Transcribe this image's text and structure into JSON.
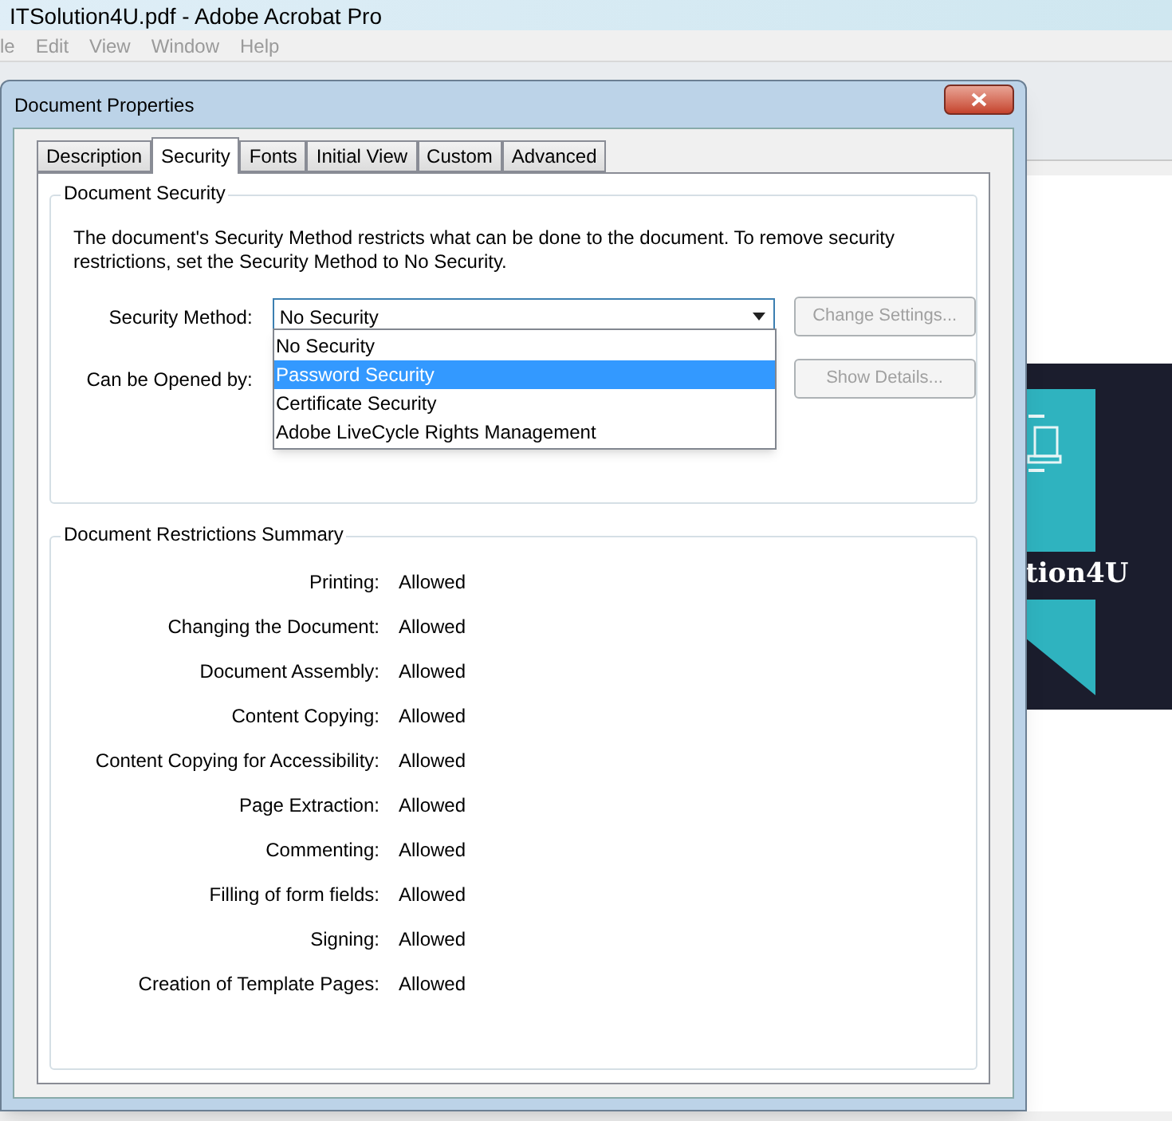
{
  "app": {
    "title": "ITSolution4U.pdf - Adobe Acrobat Pro",
    "menu": [
      "le",
      "Edit",
      "View",
      "Window",
      "Help"
    ],
    "page_text": "tion4U"
  },
  "dialog": {
    "title": "Document Properties",
    "tabs": [
      {
        "label": "Description",
        "selected": false
      },
      {
        "label": "Security",
        "selected": true
      },
      {
        "label": "Fonts",
        "selected": false
      },
      {
        "label": "Initial View",
        "selected": false
      },
      {
        "label": "Custom",
        "selected": false
      },
      {
        "label": "Advanced",
        "selected": false
      }
    ],
    "security": {
      "heading": "Document Security",
      "description": "The document's Security Method restricts what can be done to the document. To remove security restrictions, set the Security Method to No Security.",
      "method_label": "Security Method:",
      "method_value": "No Security",
      "options": [
        {
          "label": "No Security",
          "selected": false
        },
        {
          "label": "Password Security",
          "selected": true
        },
        {
          "label": "Certificate Security",
          "selected": false
        },
        {
          "label": "Adobe LiveCycle Rights Management",
          "selected": false
        }
      ],
      "opened_by_label": "Can be Opened by:",
      "buttons": [
        {
          "label": "Change Settings...",
          "disabled": true
        },
        {
          "label": "Show Details...",
          "disabled": true
        }
      ]
    },
    "restrictions": {
      "heading": "Document Restrictions Summary",
      "rows": [
        {
          "label": "Printing:",
          "value": "Allowed"
        },
        {
          "label": "Changing the Document:",
          "value": "Allowed"
        },
        {
          "label": "Document Assembly:",
          "value": "Allowed"
        },
        {
          "label": "Content Copying:",
          "value": "Allowed"
        },
        {
          "label": "Content Copying for Accessibility:",
          "value": "Allowed"
        },
        {
          "label": "Page Extraction:",
          "value": "Allowed"
        },
        {
          "label": "Commenting:",
          "value": "Allowed"
        },
        {
          "label": "Filling of form fields:",
          "value": "Allowed"
        },
        {
          "label": "Signing:",
          "value": "Allowed"
        },
        {
          "label": "Creation of Template Pages:",
          "value": "Allowed"
        }
      ]
    }
  }
}
